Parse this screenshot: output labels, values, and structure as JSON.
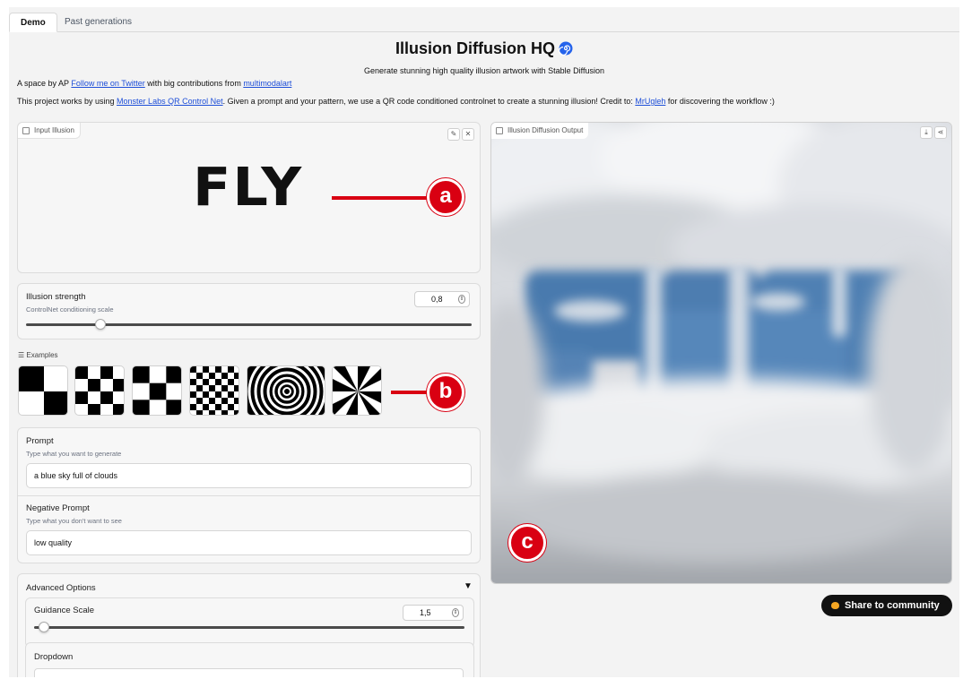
{
  "tabs": [
    {
      "label": "Demo",
      "active": true
    },
    {
      "label": "Past generations",
      "active": false
    }
  ],
  "header": {
    "title": "Illusion Diffusion HQ",
    "title_icon": "spiral-emoji-icon",
    "subtitle": "Generate stunning high quality illusion artwork with Stable Diffusion"
  },
  "credits": {
    "line1_prefix": "A space by AP ",
    "line1_link1": "Follow me on Twitter",
    "line1_middle": " with big contributions from ",
    "line1_link2": "multimodalart",
    "line2_prefix": "This project works by using ",
    "line2_link1": "Monster Labs QR Control Net",
    "line2_middle": ". Given a prompt and your pattern, we use a QR code conditioned controlnet to create a stunning illusion! Credit to: ",
    "line2_link2": "MrUgleh",
    "line2_suffix": " for discovering the workflow :)"
  },
  "input_illusion": {
    "label": "Input Illusion",
    "image_text": "FLY",
    "edit_icon": "pencil-icon",
    "close_icon": "close-icon"
  },
  "annotations": {
    "a": "a",
    "b": "b",
    "c": "c",
    "color": "#d90012"
  },
  "illusion_strength": {
    "title": "Illusion strength",
    "info": "ControlNet conditioning scale",
    "value": "0,8"
  },
  "examples": {
    "label": "Examples",
    "items": [
      "checker-2x2",
      "checker-4x4",
      "checker-3x3",
      "checker-6x6",
      "spiral-circles",
      "spiral-swirl"
    ]
  },
  "prompt": {
    "title": "Prompt",
    "info": "Type what you want to generate",
    "value": "a blue sky full of clouds"
  },
  "negative_prompt": {
    "title": "Negative Prompt",
    "info": "Type what you don't want to see",
    "value": "low quality"
  },
  "advanced": {
    "title": "Advanced Options",
    "toggle_glyph": "▼",
    "guidance": {
      "title": "Guidance Scale",
      "value": "1,5"
    },
    "dropdown": {
      "title": "Dropdown"
    }
  },
  "output": {
    "label": "Illusion Diffusion Output",
    "download_icon": "download-icon",
    "share_icon": "share-icon"
  },
  "share_button": {
    "label": "Share to community",
    "icon": "hugging-face-icon"
  }
}
